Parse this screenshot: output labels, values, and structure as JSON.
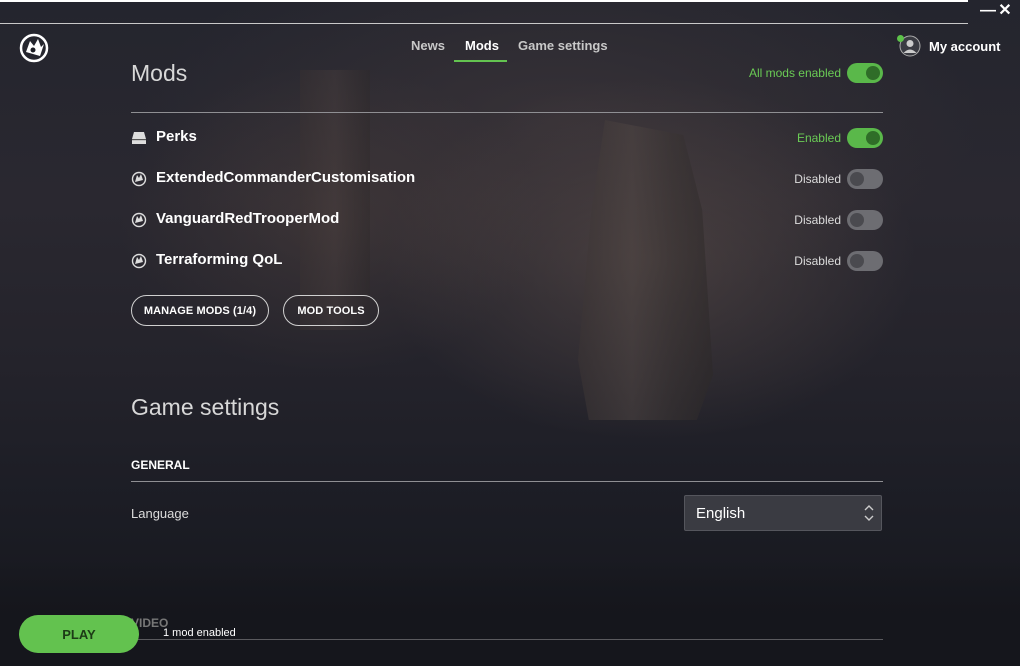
{
  "window": {
    "minimize_glyph": "—",
    "close_glyph": "✕"
  },
  "nav": {
    "tabs": [
      {
        "label": "News",
        "active": false
      },
      {
        "label": "Mods",
        "active": true
      },
      {
        "label": "Game settings",
        "active": false
      }
    ],
    "account_label": "My account",
    "account_online": true
  },
  "mods": {
    "title": "Mods",
    "all_enabled_label": "All mods enabled",
    "all_enabled": true,
    "items": [
      {
        "name": "Perks",
        "icon": "drive-icon",
        "enabled": true,
        "status": "Enabled"
      },
      {
        "name": "ExtendedCommanderCustomisation",
        "icon": "steam-workshop-icon",
        "enabled": false,
        "status": "Disabled"
      },
      {
        "name": "VanguardRedTrooperMod",
        "icon": "steam-workshop-icon",
        "enabled": false,
        "status": "Disabled"
      },
      {
        "name": "Terraforming QoL",
        "icon": "steam-workshop-icon",
        "enabled": false,
        "status": "Disabled"
      }
    ],
    "manage_button": "MANAGE MODS (1/4)",
    "tools_button": "MOD TOOLS"
  },
  "game_settings": {
    "title": "Game settings",
    "general_heading": "GENERAL",
    "language_label": "Language",
    "language_value": "English",
    "video_heading": "VIDEO"
  },
  "footer": {
    "play_label": "PLAY",
    "status": "1 mod enabled"
  },
  "colors": {
    "accent": "#63c24f",
    "background": "#1c1d24"
  }
}
